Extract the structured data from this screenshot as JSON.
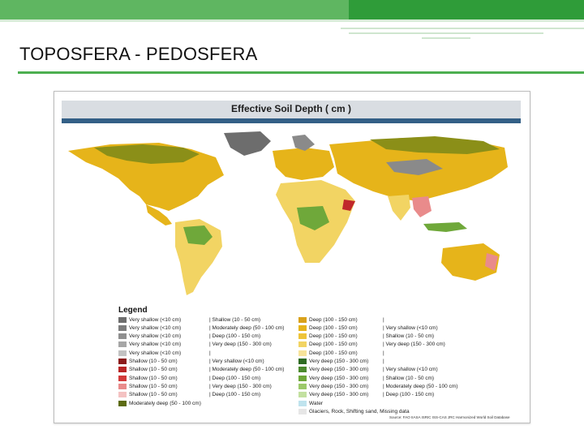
{
  "header": {
    "title": "TOPOSFERA - PEDOSFERA"
  },
  "map": {
    "title": "Effective Soil Depth ( cm )",
    "colors": {
      "ocean": "#ffffff",
      "very_shallow": "#8a8a8a",
      "deep_yellow": "#e6b41a",
      "light_yellow": "#f2d463",
      "olive": "#8b8f18",
      "green": "#6fa83a",
      "light_green": "#bfe0a6",
      "red": "#c0282b",
      "pink": "#e98b8b"
    }
  },
  "legend": {
    "title": "Legend",
    "columns": [
      [
        {
          "label": "Very shallow (<10 cm)",
          "color": "#6d6d6d"
        },
        {
          "label": "Very shallow (<10 cm)",
          "color": "#7d7d7d"
        },
        {
          "label": "Very shallow (<10 cm)",
          "color": "#8f8f8f"
        },
        {
          "label": "Very shallow (<10 cm)",
          "color": "#a6a6a6"
        },
        {
          "label": "Very shallow (<10 cm)",
          "color": "#c2c2c2"
        },
        {
          "label": "Shallow (10 - 50 cm)",
          "color": "#8b1a1a"
        },
        {
          "label": "Shallow (10 - 50 cm)",
          "color": "#b82525"
        },
        {
          "label": "Shallow (10 - 50 cm)",
          "color": "#d23a3a"
        },
        {
          "label": "Shallow (10 - 50 cm)",
          "color": "#e98b8b"
        },
        {
          "label": "Shallow (10 - 50 cm)",
          "color": "#f4c2c2"
        },
        {
          "label": "Moderately deep (50 - 100 cm)",
          "color": "#5c6b12"
        }
      ],
      [
        {
          "label": "| Shallow (10 - 50 cm)",
          "color": ""
        },
        {
          "label": "| Moderately deep (50 - 100 cm)",
          "color": ""
        },
        {
          "label": "| Deep (100 - 150 cm)",
          "color": ""
        },
        {
          "label": "| Very deep (150 - 300 cm)",
          "color": ""
        },
        {
          "label": "|",
          "color": ""
        },
        {
          "label": "| Very shallow (<10 cm)",
          "color": ""
        },
        {
          "label": "| Moderately deep (50 - 100 cm)",
          "color": ""
        },
        {
          "label": "| Deep (100 - 150 cm)",
          "color": ""
        },
        {
          "label": "| Very deep (150 - 300 cm)",
          "color": ""
        },
        {
          "label": "| Deep (100 - 150 cm)",
          "color": ""
        }
      ],
      [
        {
          "label": "Deep (100 - 150 cm)",
          "color": "#d9a11a"
        },
        {
          "label": "Deep (100 - 150 cm)",
          "color": "#e6b41a"
        },
        {
          "label": "Deep (100 - 150 cm)",
          "color": "#eec43a"
        },
        {
          "label": "Deep (100 - 150 cm)",
          "color": "#f2d463"
        },
        {
          "label": "Deep (100 - 150 cm)",
          "color": "#f7e39a"
        },
        {
          "label": "Very deep (150 - 300 cm)",
          "color": "#2e6b22"
        },
        {
          "label": "Very deep (150 - 300 cm)",
          "color": "#4c8a2e"
        },
        {
          "label": "Very deep (150 - 300 cm)",
          "color": "#6fa83a"
        },
        {
          "label": "Very deep (150 - 300 cm)",
          "color": "#9cc96a"
        },
        {
          "label": "Very deep (150 - 300 cm)",
          "color": "#c3e0a0"
        },
        {
          "label": "Water",
          "color": "#bfe3ee"
        },
        {
          "label": "Glaciers, Rock, Shifting sand, Missing data",
          "color": "#e6e6e6"
        }
      ],
      [
        {
          "label": "|",
          "color": ""
        },
        {
          "label": "| Very shallow (<10 cm)",
          "color": ""
        },
        {
          "label": "| Shallow (10 - 50 cm)",
          "color": ""
        },
        {
          "label": "| Very deep (150 - 300 cm)",
          "color": ""
        },
        {
          "label": "|",
          "color": ""
        },
        {
          "label": "|",
          "color": ""
        },
        {
          "label": "| Very shallow (<10 cm)",
          "color": ""
        },
        {
          "label": "| Shallow (10 - 50 cm)",
          "color": ""
        },
        {
          "label": "| Moderately deep (50 - 100 cm)",
          "color": ""
        },
        {
          "label": "| Deep (100 - 150 cm)",
          "color": ""
        }
      ]
    ],
    "source": "Source: FAO IIASA ISRIC ISS-CAS JRC Harmonized World Soil Database"
  }
}
